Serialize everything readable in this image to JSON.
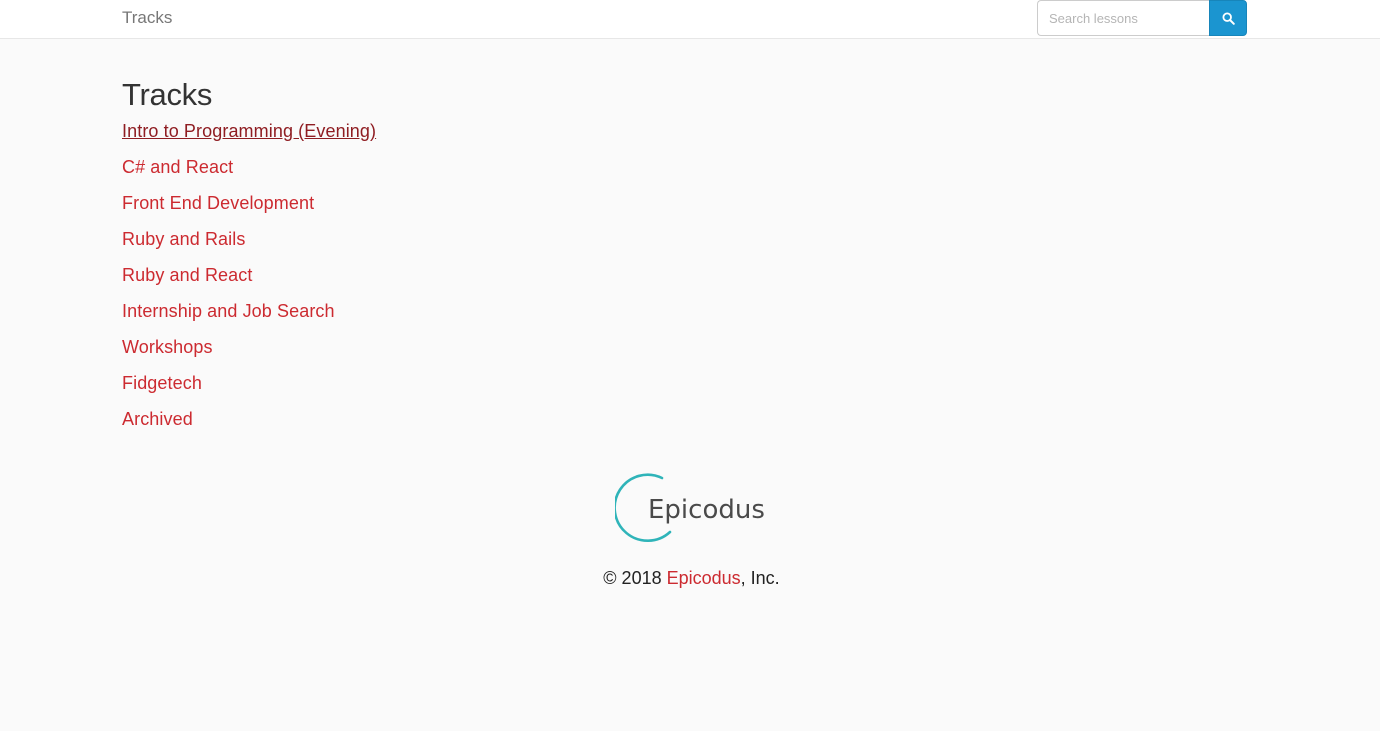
{
  "navbar": {
    "brand": "Tracks",
    "search": {
      "placeholder": "Search lessons",
      "value": "",
      "button_icon": "search-icon",
      "button_color": "#1b95d0"
    }
  },
  "main": {
    "title": "Tracks",
    "tracks": [
      {
        "label": "Intro to Programming (Evening)"
      },
      {
        "label": "C# and React"
      },
      {
        "label": "Front End Development"
      },
      {
        "label": "Ruby and Rails"
      },
      {
        "label": "Ruby and React"
      },
      {
        "label": "Internship and Job Search"
      },
      {
        "label": "Workshops"
      },
      {
        "label": "Fidgetech"
      },
      {
        "label": "Archived"
      }
    ],
    "link_color": "#cc2a30",
    "visited_link_color": "#8f1d22"
  },
  "footer": {
    "logo_text": "Epicodus",
    "logo_color": "#2fb4b9",
    "copyright_prefix": "© 2018 ",
    "copyright_link": "Epicodus",
    "copyright_suffix": ", Inc."
  }
}
